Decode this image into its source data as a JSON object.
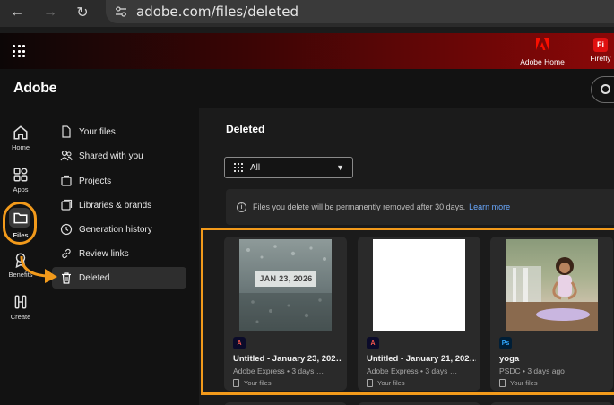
{
  "browser": {
    "url": "adobe.com/files/deleted",
    "back_icon": "arrow-left-icon",
    "forward_icon": "arrow-right-icon",
    "reload_icon": "reload-icon"
  },
  "header": {
    "adobe_home_label": "Adobe Home",
    "firefly_label": "Firefly",
    "firefly_logo": "Fi"
  },
  "brand": "Adobe",
  "rail": {
    "home": "Home",
    "apps": "Apps",
    "files": "Files",
    "benefits": "Benefits",
    "create": "Create"
  },
  "sidenav": {
    "items": [
      {
        "label": "Your files",
        "icon": "file-icon"
      },
      {
        "label": "Shared with you",
        "icon": "people-icon"
      },
      {
        "label": "Projects",
        "icon": "projects-icon"
      },
      {
        "label": "Libraries & brands",
        "icon": "libraries-icon"
      },
      {
        "label": "Generation history",
        "icon": "history-icon"
      },
      {
        "label": "Review links",
        "icon": "link-icon"
      },
      {
        "label": "Deleted",
        "icon": "trash-icon"
      }
    ]
  },
  "main": {
    "title": "Deleted",
    "filter_value": "All",
    "info_text": "Files you delete will be permanently removed after 30 days.",
    "info_link": "Learn more",
    "cards": [
      {
        "title": "Untitled - January 23, 202…",
        "meta": "Adobe Express • 3 days …",
        "location": "Your files",
        "badge": "A",
        "thumb_text": "JAN 23, 2026"
      },
      {
        "title": "Untitled - January 21, 202…",
        "meta": "Adobe Express • 3 days …",
        "location": "Your files",
        "badge": "A"
      },
      {
        "title": "yoga",
        "meta": "PSDC • 3 days ago",
        "location": "Your files",
        "badge": "Ps"
      }
    ]
  },
  "colors": {
    "accent_orange": "#f29a1b",
    "adobe_red": "#e01010",
    "link_blue": "#6aa9ff"
  }
}
